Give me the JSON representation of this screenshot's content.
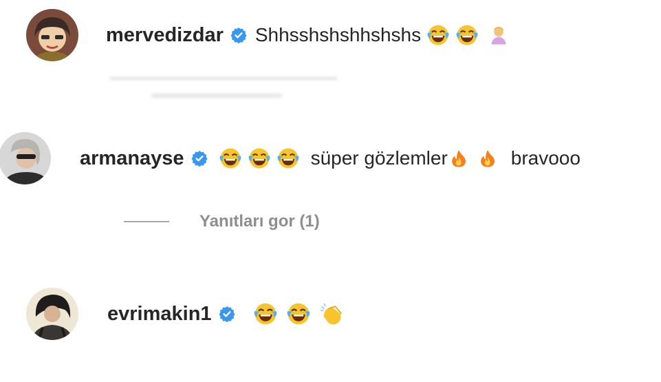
{
  "comments": [
    {
      "username": "mervedizdar",
      "text": "Shhsshshshhshshs",
      "emojis": [
        "face-with-tears-of-joy",
        "face-with-tears-of-joy",
        "person-bowing"
      ]
    },
    {
      "username": "armanayse",
      "text_before_emojis": "",
      "text_mid": "süper gözlemler",
      "text_end": "bravooo",
      "emojis": [
        "face-with-tears-of-joy",
        "face-with-tears-of-joy",
        "face-with-tears-of-joy",
        "fire",
        "fire"
      ]
    },
    {
      "username": "evrimakin1",
      "text": "",
      "emojis": [
        "face-with-tears-of-joy",
        "face-with-tears-of-joy",
        "clapping-hands"
      ]
    }
  ],
  "replies_link": "Yanıtları gor (1)",
  "colors": {
    "verified_blue": "#3897f0",
    "username": "#262626",
    "muted": "#8e8e8e",
    "emoji_yellow": "#f7c42f",
    "fire_orange": "#f4801f"
  }
}
